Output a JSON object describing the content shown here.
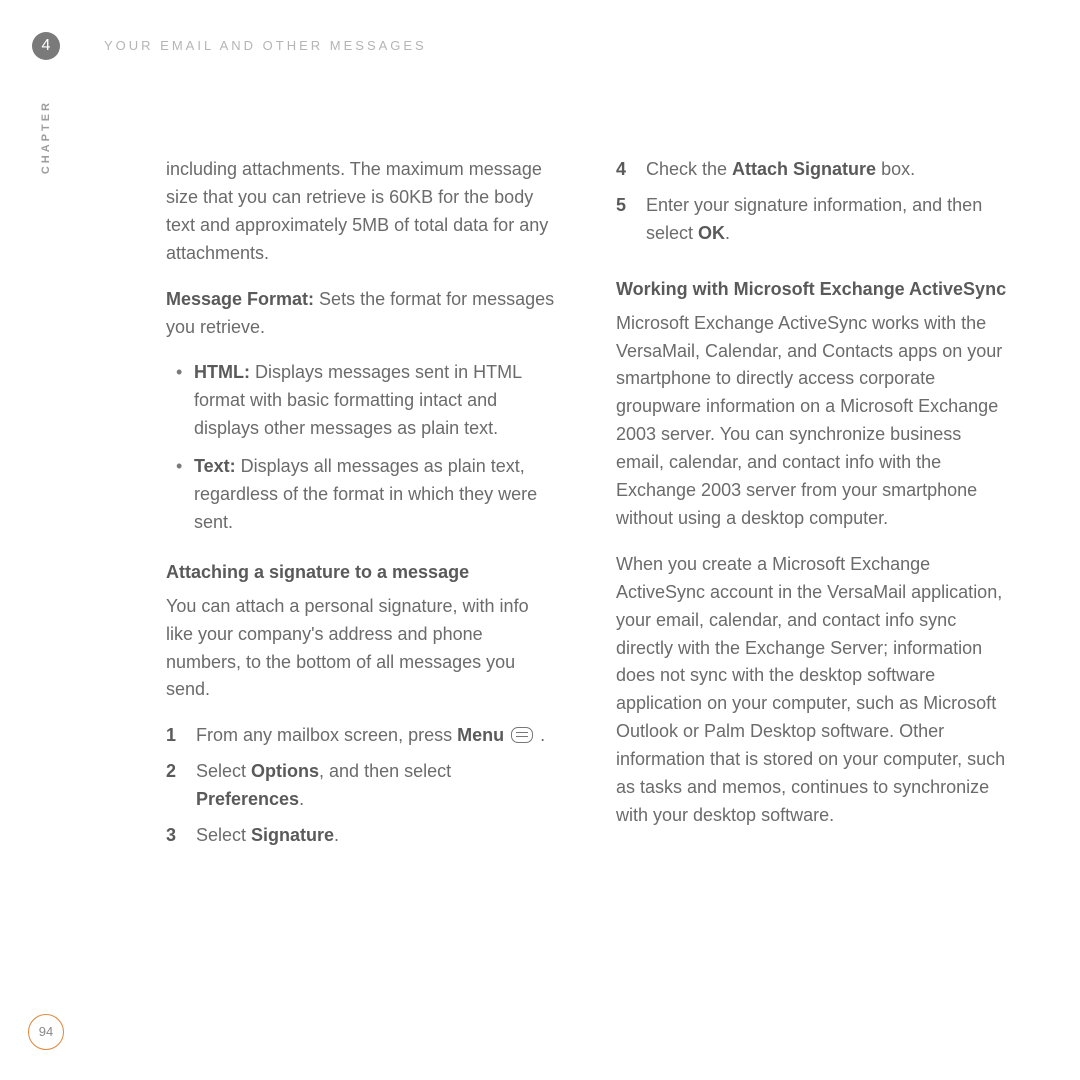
{
  "header": {
    "chapter_badge": "4",
    "running_head": "YOUR EMAIL AND OTHER MESSAGES",
    "chapter_tab": "CHAPTER"
  },
  "footer": {
    "page_number": "94"
  },
  "labels": {
    "message_format": "Message Format:",
    "html_bullet": "HTML:",
    "text_bullet": "Text:"
  },
  "bold": {
    "attach_signature": "Attach Signature",
    "ok": "OK",
    "menu_word": "Menu",
    "options": "Options",
    "preferences": "Preferences",
    "signature": "Signature"
  },
  "body": {
    "intro": "including attachments. The maximum message size that you can retrieve is 60KB for the body text and approximately 5MB of total data for any attachments.",
    "mf_after": " Sets the format for messages you retrieve.",
    "html_after": " Displays messages sent in HTML format with basic formatting intact and displays other messages as plain text.",
    "text_after": " Displays all messages as plain text, regardless of the format in which they were sent.",
    "sig_head": "Attaching a signature to a message",
    "sig_intro": "You can attach a personal signature, with info like your company's address and phone numbers, to the bottom of all messages you send.",
    "s1_a": "From any mailbox screen, press ",
    "s1_b": " .",
    "s2_a": "Select ",
    "s2_b": ", and then select ",
    "s2_c": ".",
    "s3_a": "Select ",
    "s3_b": ".",
    "s4_a": "Check the ",
    "s4_b": " box.",
    "s5_a": "Enter your signature information, and then select ",
    "s5_b": ".",
    "as_head": "Working with Microsoft Exchange ActiveSync",
    "as_p1": "Microsoft Exchange ActiveSync works with the VersaMail, Calendar, and Contacts apps on your smartphone to directly access corporate groupware information on a Microsoft Exchange 2003 server. You can synchronize business email, calendar, and contact info with the Exchange 2003 server from your smartphone without using a desktop computer.",
    "as_p2": "When you create a Microsoft Exchange ActiveSync account in the VersaMail application, your email, calendar, and contact info sync directly with the Exchange Server; information does not sync with the desktop software application on your computer, such as Microsoft Outlook or Palm Desktop software. Other information that is stored on your computer, such as tasks and memos, continues to synchronize with your desktop software."
  },
  "step_nums": {
    "n1": "1",
    "n2": "2",
    "n3": "3",
    "n4": "4",
    "n5": "5"
  }
}
